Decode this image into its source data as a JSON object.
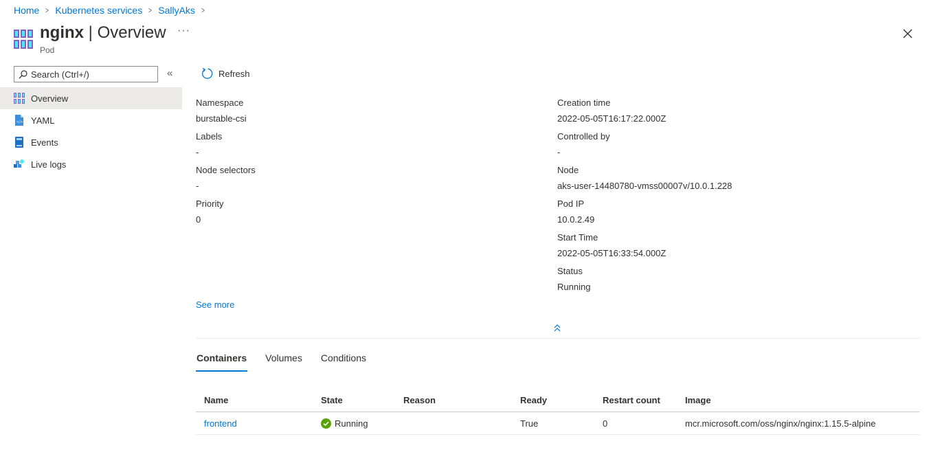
{
  "breadcrumb": [
    {
      "label": "Home"
    },
    {
      "label": "Kubernetes services"
    },
    {
      "label": "SallyAks"
    }
  ],
  "header": {
    "name": "nginx",
    "separator": " | ",
    "page": "Overview",
    "subtitle": "Pod",
    "more": "···"
  },
  "sidebar": {
    "search_placeholder": "Search (Ctrl+/)",
    "collapse": "«",
    "items": [
      {
        "label": "Overview",
        "icon": "pod-icon"
      },
      {
        "label": "YAML",
        "icon": "yaml-file-icon"
      },
      {
        "label": "Events",
        "icon": "events-icon"
      },
      {
        "label": "Live logs",
        "icon": "live-logs-icon"
      }
    ]
  },
  "toolbar": {
    "refresh_label": "Refresh"
  },
  "properties": {
    "left": [
      {
        "label": "Namespace",
        "value": "burstable-csi"
      },
      {
        "label": "Labels",
        "value": "-"
      },
      {
        "label": "Node selectors",
        "value": "-"
      },
      {
        "label": "Priority",
        "value": "0"
      }
    ],
    "right": [
      {
        "label": "Creation time",
        "value": "2022-05-05T16:17:22.000Z"
      },
      {
        "label": "Controlled by",
        "value": "-"
      },
      {
        "label": "Node",
        "value": "aks-user-14480780-vmss00007v/10.0.1.228"
      },
      {
        "label": "Pod IP",
        "value": "10.0.2.49"
      },
      {
        "label": "Start Time",
        "value": "2022-05-05T16:33:54.000Z"
      },
      {
        "label": "Status",
        "value": "Running"
      }
    ]
  },
  "see_more": "See more",
  "tabs": [
    {
      "label": "Containers",
      "active": true
    },
    {
      "label": "Volumes",
      "active": false
    },
    {
      "label": "Conditions",
      "active": false
    }
  ],
  "table": {
    "columns": [
      "Name",
      "State",
      "Reason",
      "Ready",
      "Restart count",
      "Image"
    ],
    "rows": [
      {
        "name": "frontend",
        "state": "Running",
        "reason": "",
        "ready": "True",
        "restart_count": "0",
        "image": "mcr.microsoft.com/oss/nginx/nginx:1.15.5-alpine"
      }
    ]
  },
  "colors": {
    "accent": "#0078d4",
    "success": "#57a300",
    "selected_bg": "#edebe9"
  }
}
